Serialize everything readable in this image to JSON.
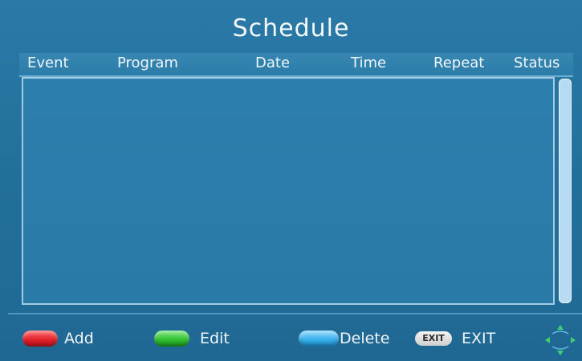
{
  "screen": {
    "title": "Schedule"
  },
  "table": {
    "columns": {
      "event": "Event",
      "program": "Program",
      "date": "Date",
      "time": "Time",
      "repeat": "Repeat",
      "status": "Status"
    },
    "rows": []
  },
  "footer": {
    "add_label": "Add",
    "edit_label": "Edit",
    "delete_label": "Delete",
    "exit_key_label": "EXIT",
    "exit_label": "EXIT"
  },
  "colors": {
    "background": "#236f9c",
    "red_key": "#e0202a",
    "green_key": "#2fbf2f",
    "blue_key": "#35aee8",
    "dpad": "#3fd070"
  },
  "icons": {
    "red_key": "red-color-key-icon",
    "green_key": "green-color-key-icon",
    "blue_key": "blue-color-key-icon",
    "exit_key": "exit-key-icon",
    "navigation": "dpad-arrows-icon"
  }
}
